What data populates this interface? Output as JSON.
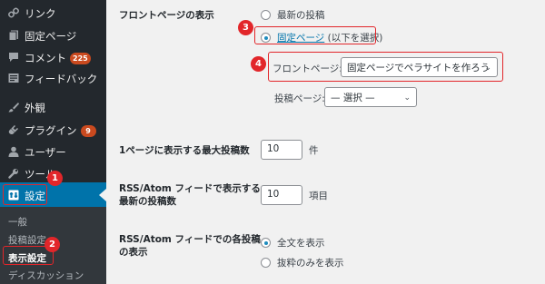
{
  "sidebar": {
    "items": [
      {
        "label": "リンク",
        "icon": "link-icon"
      },
      {
        "label": "固定ページ",
        "icon": "page-icon"
      },
      {
        "label": "コメント",
        "icon": "comment-icon",
        "badge": "225"
      },
      {
        "label": "フィードバック",
        "icon": "feedback-icon"
      },
      {
        "label": "外観",
        "icon": "brush-icon"
      },
      {
        "label": "プラグイン",
        "icon": "plugin-icon",
        "badge": "9"
      },
      {
        "label": "ユーザー",
        "icon": "user-icon"
      },
      {
        "label": "ツール",
        "icon": "wrench-icon"
      },
      {
        "label": "設定",
        "icon": "settings-icon"
      }
    ],
    "submenu": [
      "一般",
      "投稿設定",
      "表示設定",
      "ディスカッション"
    ]
  },
  "markers": [
    "1",
    "2",
    "3",
    "4"
  ],
  "settings": {
    "front_page": {
      "heading": "フロントページの表示",
      "option_latest": "最新の投稿",
      "option_static_link": "固定ページ",
      "option_static_rest": " (以下を選択)",
      "front_label": "フロントページ:",
      "front_value": "固定ページでペラサイトを作ろう",
      "posts_label": "投稿ページ:",
      "posts_value": "— 選択 —"
    },
    "posts_per_page": {
      "heading": "1ページに表示する最大投稿数",
      "value": "10",
      "unit": "件"
    },
    "rss_count": {
      "heading_line1": "RSS/Atom フィードで表示する",
      "heading_line2": "最新の投稿数",
      "value": "10",
      "unit": "項目"
    },
    "rss_display": {
      "heading_line1": "RSS/Atom フィードでの各投稿",
      "heading_line2": "の表示",
      "option_full": "全文を表示",
      "option_excerpt": "抜粋のみを表示"
    }
  },
  "colors": {
    "sidebar": "#23282d",
    "submenu": "#32373c",
    "active": "#0073aa",
    "highlight": "#e2262a",
    "badge": "#ca4a1f"
  }
}
